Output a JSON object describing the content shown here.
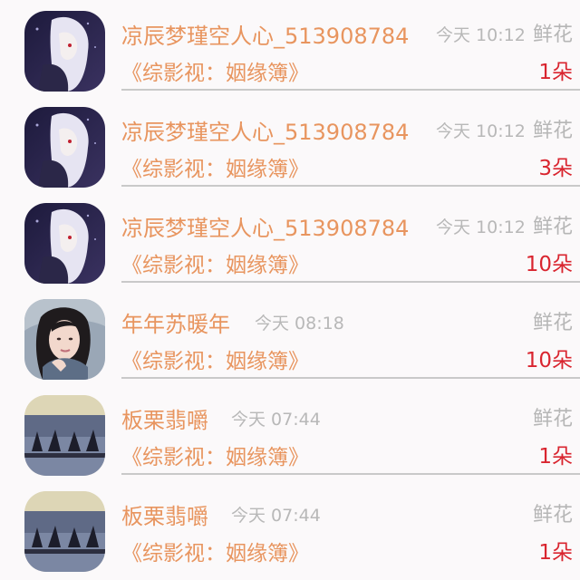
{
  "rows": [
    {
      "name": "凉辰梦瑾空人心_513908784",
      "time": "今天 10:12",
      "gift": "鲜花",
      "book": "《综影视：姻缘簿》",
      "count": "1朵",
      "avatar": "anime-avatar"
    },
    {
      "name": "凉辰梦瑾空人心_513908784",
      "time": "今天 10:12",
      "gift": "鲜花",
      "book": "《综影视：姻缘簿》",
      "count": "3朵",
      "avatar": "anime-avatar"
    },
    {
      "name": "凉辰梦瑾空人心_513908784",
      "time": "今天 10:12",
      "gift": "鲜花",
      "book": "《综影视：姻缘簿》",
      "count": "10朵",
      "avatar": "anime-avatar"
    },
    {
      "name": "年年苏暖年",
      "time": "今天 08:18",
      "gift": "鲜花",
      "book": "《综影视：姻缘簿》",
      "count": "10朵",
      "avatar": "portrait-avatar"
    },
    {
      "name": "板栗翡嚼",
      "time": "今天 07:44",
      "gift": "鲜花",
      "book": "《综影视：姻缘簿》",
      "count": "1朵",
      "avatar": "silhouette-avatar"
    },
    {
      "name": "板栗翡嚼",
      "time": "今天 07:44",
      "gift": "鲜花",
      "book": "《综影视：姻缘簿》",
      "count": "1朵",
      "avatar": "silhouette-avatar"
    }
  ],
  "colors": {
    "name": "#e8955f",
    "book": "#e8955f",
    "time": "#b8b8b8",
    "gift": "#b6b6b6",
    "count": "#d9252f",
    "divider": "#c9c9c9",
    "background": "#fbf9fa"
  }
}
